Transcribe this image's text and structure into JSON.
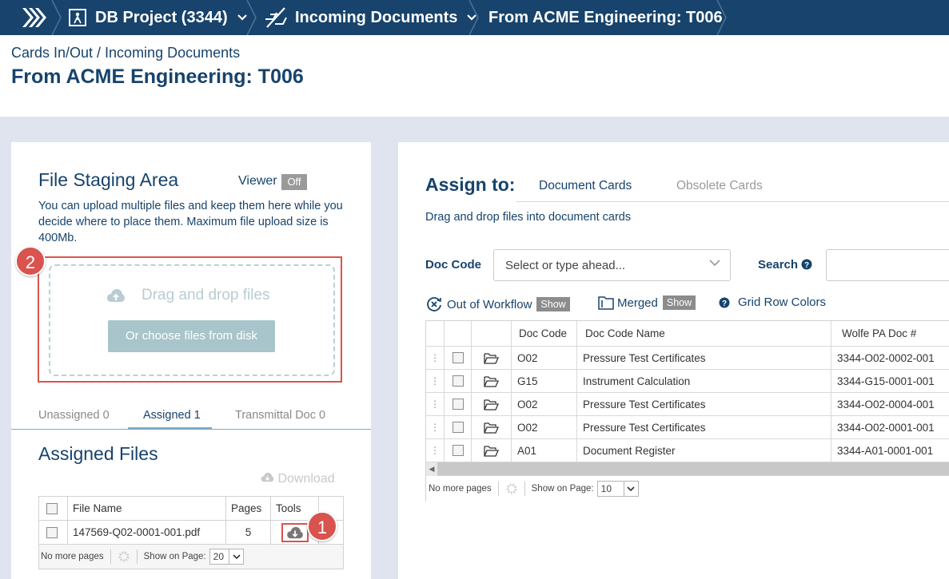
{
  "breadcrumb": {
    "project": "DB Project (3344)",
    "section": "Incoming Documents",
    "current": "From ACME Engineering: T006"
  },
  "header": {
    "subpath": "Cards In/Out / Incoming Documents",
    "title": "From ACME Engineering: T006"
  },
  "staging": {
    "title": "File Staging Area",
    "viewer_label": "Viewer",
    "viewer_state": "Off",
    "description": "You can upload multiple files and keep them here while you decide where to place them. Maximum file upload size is 400Mb.",
    "drop_label": "Drag and drop files",
    "choose_button": "Or choose files from disk",
    "badge": "2"
  },
  "file_tabs": [
    {
      "label": "Unassigned 0",
      "active": false
    },
    {
      "label": "Assigned 1",
      "active": true
    },
    {
      "label": "Transmittal Doc 0",
      "active": false
    }
  ],
  "assigned": {
    "title": "Assigned Files",
    "download_label": "Download",
    "columns": [
      "File Name",
      "Pages",
      "Tools"
    ],
    "rows": [
      {
        "file_name": "147569-Q02-0001-001.pdf",
        "pages": "5"
      }
    ],
    "tools_badge": "1",
    "pager_text": "No more pages",
    "show_on_page_label": "Show on Page:",
    "page_size": "20"
  },
  "assign": {
    "title": "Assign to:",
    "tabs": [
      {
        "label": "Document Cards",
        "active": true
      },
      {
        "label": "Obsolete Cards",
        "active": false
      }
    ],
    "hint": "Drag and drop files into document cards",
    "doc_code_label": "Doc Code",
    "doc_code_placeholder": "Select or type ahead...",
    "search_label": "Search",
    "options": {
      "out_of_workflow": "Out of Workflow",
      "merged": "Merged",
      "show": "Show",
      "grid_row_colors": "Grid Row Colors"
    },
    "columns": [
      "Doc Code",
      "Doc Code Name",
      "Wolfe PA Doc #"
    ],
    "rows": [
      {
        "code": "O02",
        "name": "Pressure Test Certificates",
        "doc": "3344-O02-0002-001"
      },
      {
        "code": "G15",
        "name": "Instrument Calculation",
        "doc": "3344-G15-0001-001"
      },
      {
        "code": "O02",
        "name": "Pressure Test Certificates",
        "doc": "3344-O02-0004-001"
      },
      {
        "code": "O02",
        "name": "Pressure Test Certificates",
        "doc": "3344-O02-0001-001"
      },
      {
        "code": "A01",
        "name": "Document Register",
        "doc": "3344-A01-0001-001"
      }
    ],
    "pager_text": "No more pages",
    "show_on_page_label": "Show on Page:",
    "page_size": "10"
  },
  "colors": {
    "topbar": "#17436c",
    "accent_text": "#17436c",
    "badge_red": "#d9534f",
    "choose_button": "#a7c5ca"
  }
}
